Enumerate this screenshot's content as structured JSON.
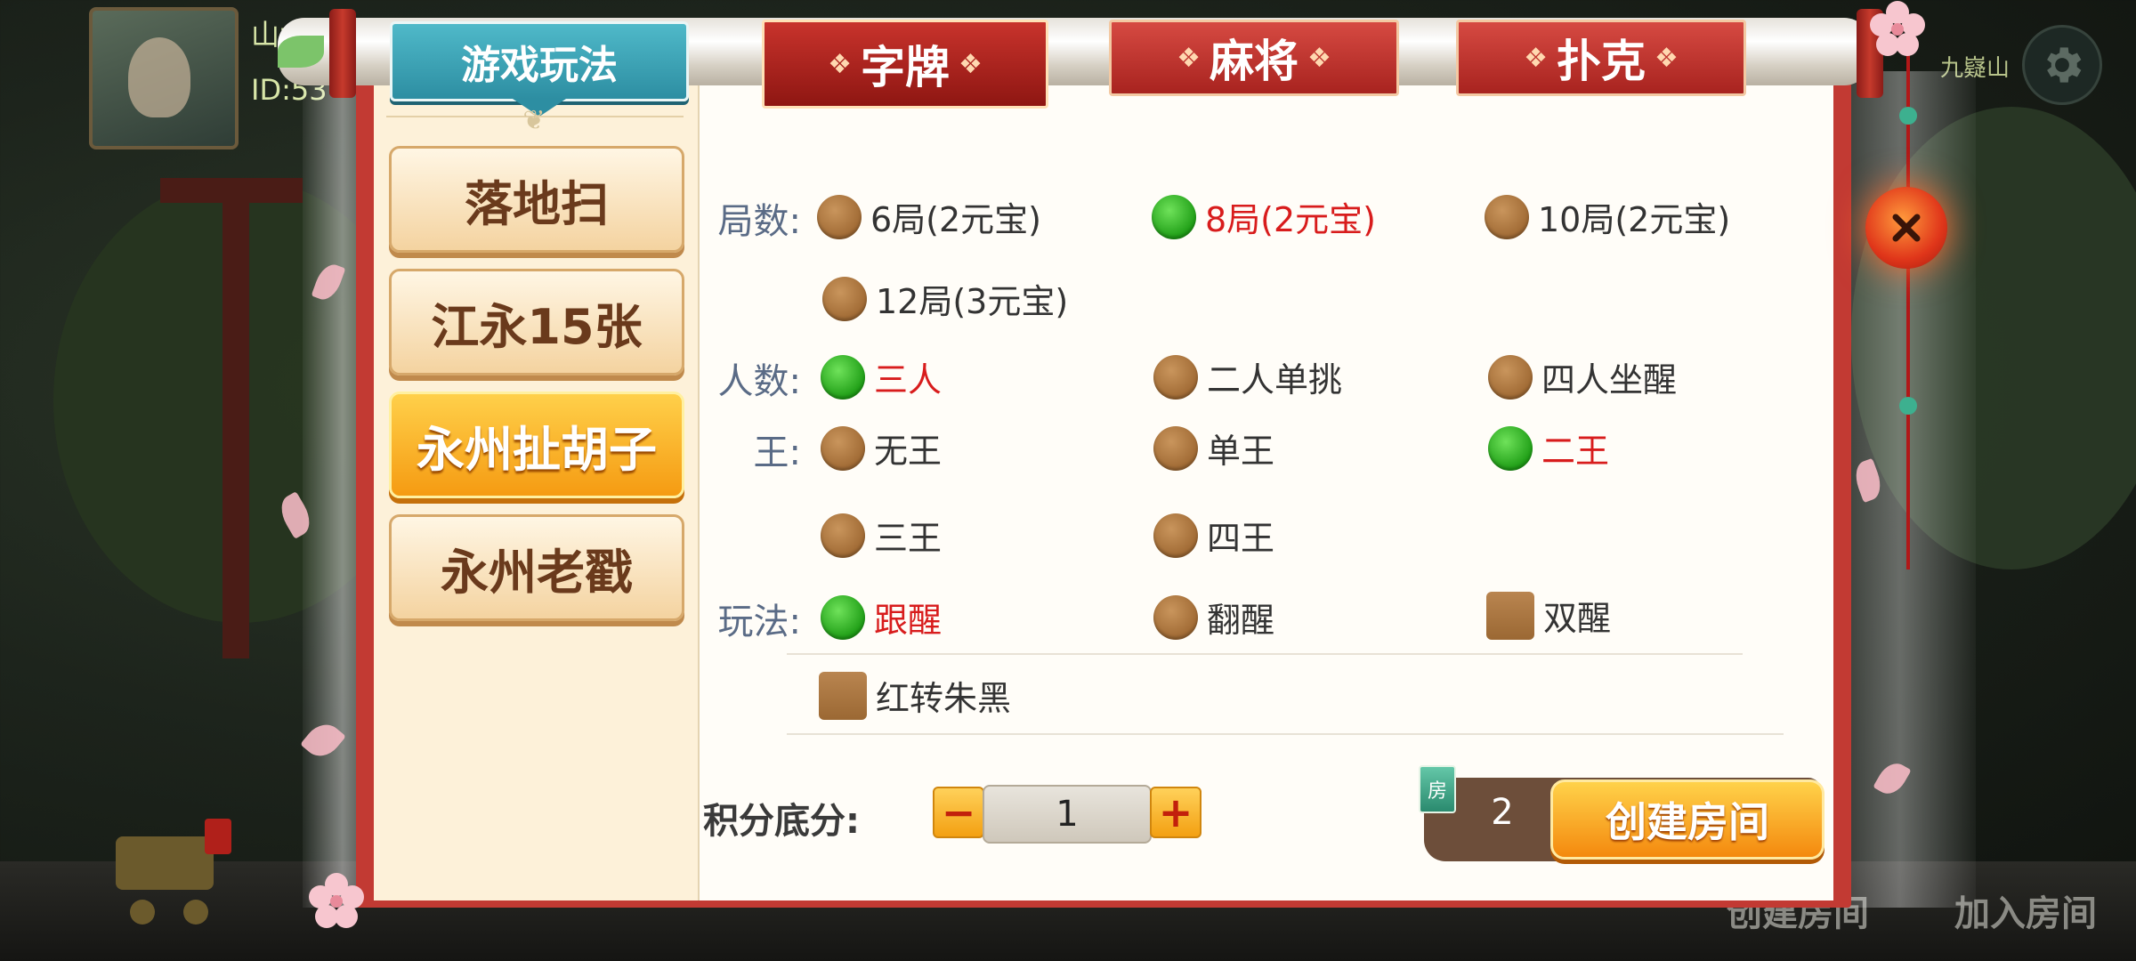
{
  "user": {
    "name": "山水",
    "id_text": "ID:53"
  },
  "top_right_label": "九嶷山",
  "scroll": {
    "help_tab": "游戏玩法",
    "categories": [
      {
        "label": "字牌",
        "active": true
      },
      {
        "label": "麻将",
        "active": false
      },
      {
        "label": "扑克",
        "active": false
      }
    ]
  },
  "sidebar": {
    "games": [
      {
        "label": "落地扫",
        "active": false
      },
      {
        "label": "江永15张",
        "active": false
      },
      {
        "label": "永州扯胡子",
        "active": true
      },
      {
        "label": "永州老戳",
        "active": false
      }
    ]
  },
  "options": {
    "rounds": {
      "label": "局数:",
      "choices": [
        {
          "label": "6局(2元宝)",
          "selected": false
        },
        {
          "label": "8局(2元宝)",
          "selected": true
        },
        {
          "label": "10局(2元宝)",
          "selected": false
        },
        {
          "label": "12局(3元宝)",
          "selected": false
        }
      ]
    },
    "players": {
      "label": "人数:",
      "choices": [
        {
          "label": "三人",
          "selected": true
        },
        {
          "label": "二人单挑",
          "selected": false
        },
        {
          "label": "四人坐醒",
          "selected": false
        }
      ]
    },
    "king": {
      "label": "王:",
      "choices": [
        {
          "label": "无王",
          "selected": false
        },
        {
          "label": "单王",
          "selected": false
        },
        {
          "label": "二王",
          "selected": true
        },
        {
          "label": "三王",
          "selected": false
        },
        {
          "label": "四王",
          "selected": false
        }
      ]
    },
    "rules": {
      "label": "玩法:",
      "choices": [
        {
          "label": "跟醒",
          "selected": true
        },
        {
          "label": "翻醒",
          "selected": false
        }
      ],
      "checkboxes": [
        {
          "label": "双醒",
          "checked": false
        },
        {
          "label": "红转朱黑",
          "checked": false
        }
      ]
    }
  },
  "score": {
    "label": "积分底分:",
    "value": "1",
    "minus": "−",
    "plus": "+"
  },
  "create": {
    "card_icon": "房",
    "card_count": "2",
    "button": "创建房间"
  },
  "bottom_bar": {
    "create_room": "创建房间",
    "join_room": "加入房间"
  },
  "colors": {
    "frame_red": "#c23a33",
    "selected_text": "#d81c1c",
    "radio_on": "#1f9e16",
    "radio_off": "#a06a34",
    "help_tab": "#2d8ea2",
    "create_button": "#f4890e"
  },
  "icons": {
    "close": "close-icon",
    "settings": "gear-icon",
    "room_card": "room-card-icon"
  }
}
